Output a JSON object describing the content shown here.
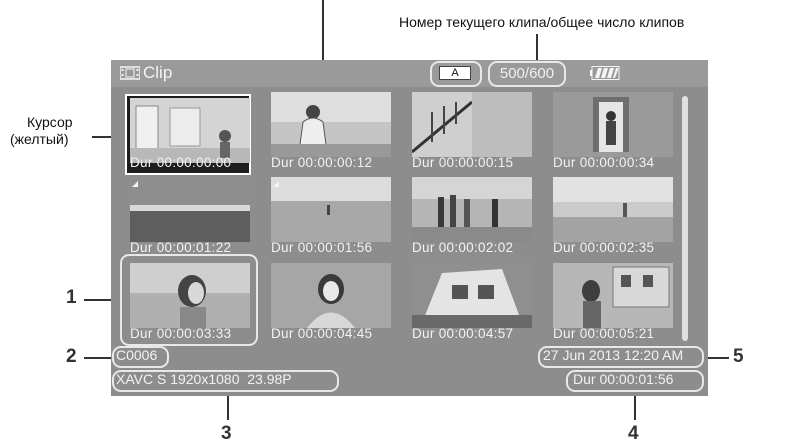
{
  "header_label": "Номер текущего клипа/общее число клипов",
  "cursor_label": {
    "line1": "Курсор",
    "line2": "(желтый)"
  },
  "screen": {
    "title": "Clip",
    "media_slot": "A",
    "clip_count": "500/600",
    "icons": [
      "film-icon",
      "battery-icon"
    ]
  },
  "clips": [
    {
      "duration": "Dur 00:00:00:00"
    },
    {
      "duration": "Dur 00:00:00:12"
    },
    {
      "duration": "Dur 00:00:00:15"
    },
    {
      "duration": "Dur 00:00:00:34"
    },
    {
      "duration": "Dur 00:00:01:22"
    },
    {
      "duration": "Dur 00:00:01:56"
    },
    {
      "duration": "Dur 00:00:02:02"
    },
    {
      "duration": "Dur 00:00:02:35"
    },
    {
      "duration": "Dur 00:00:03:33"
    },
    {
      "duration": "Dur 00:00:04:45"
    },
    {
      "duration": "Dur 00:00:04:57"
    },
    {
      "duration": "Dur 00:00:05:21"
    }
  ],
  "info": {
    "clip_name": "C0006",
    "format": "XAVC S 1920x1080  23.98P",
    "date": "27 Jun 2013 12:20 AM",
    "duration": "Dur 00:00:01:56"
  },
  "callouts": [
    "1",
    "2",
    "3",
    "4",
    "5"
  ],
  "colors": {
    "screen_bg": "#8d8d8d",
    "titlebar_bg": "#9a9a9a",
    "text": "#f2f2f2"
  }
}
